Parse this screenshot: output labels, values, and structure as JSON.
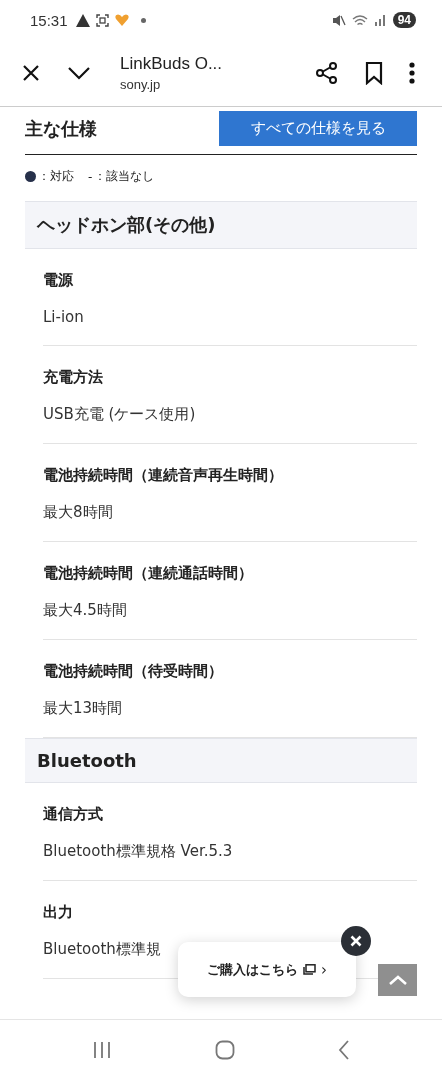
{
  "status_bar": {
    "time": "15:31",
    "battery": "94"
  },
  "toolbar": {
    "title": "LinkBuds O...",
    "url": "sony.jp"
  },
  "section": {
    "title": "主な仕様",
    "all_specs_button": "すべての仕様を見る"
  },
  "legend": {
    "supported": "：対応",
    "dash": "-",
    "not_applicable": "：該当なし"
  },
  "groups": [
    {
      "title": "ヘッドホン部(その他)",
      "specs": [
        {
          "label": "電源",
          "value": "Li-ion"
        },
        {
          "label": "充電方法",
          "value": "USB充電 (ケース使用)"
        },
        {
          "label": "電池持続時間（連続音声再生時間）",
          "value": "最大8時間"
        },
        {
          "label": "電池持続時間（連続通話時間）",
          "value": "最大4.5時間"
        },
        {
          "label": "電池持続時間（待受時間）",
          "value": "最大13時間"
        }
      ]
    },
    {
      "title": "Bluetooth",
      "specs": [
        {
          "label": "通信方式",
          "value": "Bluetooth標準規格 Ver.5.3"
        },
        {
          "label": "出力",
          "value": "Bluetooth標準規"
        }
      ]
    }
  ],
  "purchase_popup": {
    "label": "ご購入はこちら",
    "arrow": "›"
  }
}
